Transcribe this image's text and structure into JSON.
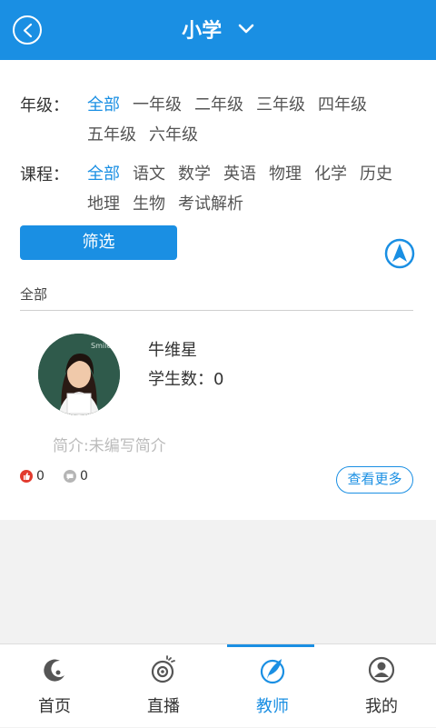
{
  "header": {
    "title": "小学",
    "back_icon": "back-circle-icon",
    "dropdown_icon": "chevron-down-icon",
    "color": "#1a8fe3"
  },
  "filters": {
    "grade": {
      "label": "年级：",
      "options": [
        "全部",
        "一年级",
        "二年级",
        "三年级",
        "四年级",
        "五年级",
        "六年级"
      ],
      "selected": "全部"
    },
    "course": {
      "label": "课程：",
      "options": [
        "全部",
        "语文",
        "数学",
        "英语",
        "物理",
        "化学",
        "历史",
        "地理",
        "生物",
        "考试解析"
      ],
      "selected": "全部"
    },
    "button_label": "筛选"
  },
  "list": {
    "section_label": "全部",
    "teachers": [
      {
        "name": "牛维星",
        "students_label": "学生数：",
        "students": "0",
        "intro_label": "简介:",
        "intro": "未编写简介",
        "likes": "0",
        "comments": "0",
        "more_label": "查看更多"
      }
    ]
  },
  "tabbar": {
    "items": [
      {
        "label": "首页",
        "icon": "home-moon-icon"
      },
      {
        "label": "直播",
        "icon": "live-camera-icon"
      },
      {
        "label": "教师",
        "icon": "teacher-feather-icon"
      },
      {
        "label": "我的",
        "icon": "profile-icon"
      }
    ],
    "active": "教师"
  }
}
